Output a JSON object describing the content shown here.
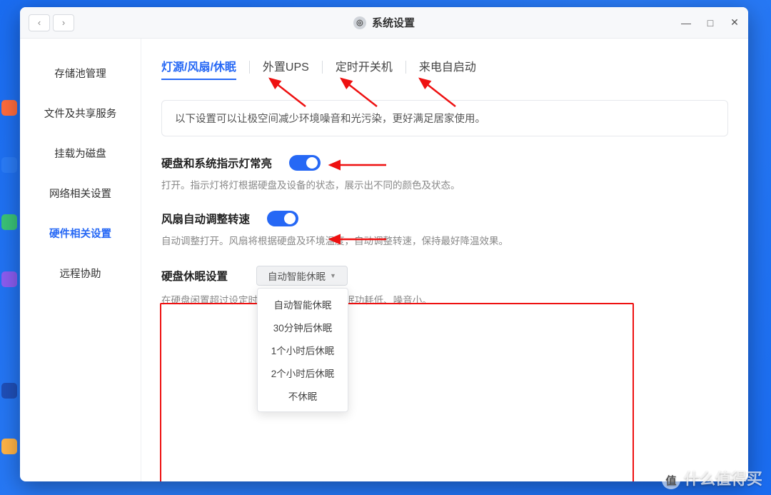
{
  "window": {
    "title": "系统设置",
    "nav_back": "‹",
    "nav_fwd": "›",
    "min": "—",
    "max": "□",
    "close": "✕"
  },
  "sidebar": {
    "items": [
      {
        "label": "存储池管理"
      },
      {
        "label": "文件及共享服务"
      },
      {
        "label": "挂载为磁盘"
      },
      {
        "label": "网络相关设置"
      },
      {
        "label": "硬件相关设置"
      },
      {
        "label": "远程协助"
      }
    ]
  },
  "tabs": [
    {
      "label": "灯源/风扇/休眠",
      "active": true
    },
    {
      "label": "外置UPS"
    },
    {
      "label": "定时开关机"
    },
    {
      "label": "来电自启动"
    }
  ],
  "info_text": "以下设置可以让极空间减少环境噪音和光污染，更好满足居家使用。",
  "setting1": {
    "title": "硬盘和系统指示灯常亮",
    "desc": "打开。指示灯将灯根据硬盘及设备的状态，展示出不同的颜色及状态。"
  },
  "setting2": {
    "title": "风扇自动调整转速",
    "desc": "自动调整打开。风扇将根据硬盘及环境温度，自动调整转速，保持最好降温效果。"
  },
  "sleep": {
    "title": "硬盘休眠设置",
    "selected": "自动智能休眠",
    "desc_pre": "在硬盘闲置超过设定时",
    "desc_post": "休眠功耗低、噪音小。",
    "options": [
      "自动智能休眠",
      "30分钟后休眠",
      "1个小时后休眠",
      "2个小时后休眠",
      "不休眠"
    ]
  },
  "watermark": "什么值得买"
}
